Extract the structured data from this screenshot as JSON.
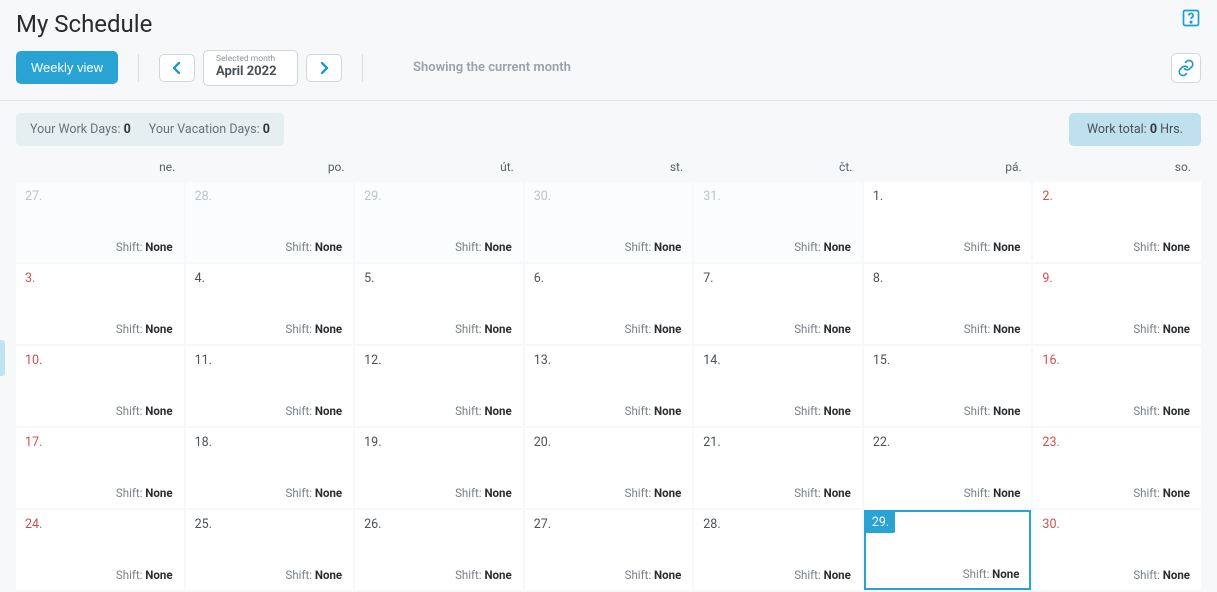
{
  "header": {
    "title": "My Schedule"
  },
  "toolbar": {
    "weekly_view_label": "Weekly view",
    "selected_month_label": "Selected month",
    "selected_month_value": "April 2022",
    "showing_text": "Showing the current month"
  },
  "summary": {
    "work_days_label": "Your Work Days:",
    "work_days_value": "0",
    "vacation_days_label": "Your Vacation Days:",
    "vacation_days_value": "0",
    "work_total_label": "Work total:",
    "work_total_value": "0",
    "work_total_unit": "Hrs."
  },
  "day_headers": [
    "ne.",
    "po.",
    "út.",
    "st.",
    "čt.",
    "pá.",
    "so."
  ],
  "shift_label": "Shift:",
  "shift_value": "None",
  "cells": [
    {
      "day": "27.",
      "faded": true,
      "weekend": false,
      "today": false
    },
    {
      "day": "28.",
      "faded": true,
      "weekend": false,
      "today": false
    },
    {
      "day": "29.",
      "faded": true,
      "weekend": false,
      "today": false
    },
    {
      "day": "30.",
      "faded": true,
      "weekend": false,
      "today": false
    },
    {
      "day": "31.",
      "faded": true,
      "weekend": false,
      "today": false
    },
    {
      "day": "1.",
      "faded": false,
      "weekend": false,
      "today": false
    },
    {
      "day": "2.",
      "faded": false,
      "weekend": true,
      "today": false
    },
    {
      "day": "3.",
      "faded": false,
      "weekend": true,
      "today": false
    },
    {
      "day": "4.",
      "faded": false,
      "weekend": false,
      "today": false
    },
    {
      "day": "5.",
      "faded": false,
      "weekend": false,
      "today": false
    },
    {
      "day": "6.",
      "faded": false,
      "weekend": false,
      "today": false
    },
    {
      "day": "7.",
      "faded": false,
      "weekend": false,
      "today": false
    },
    {
      "day": "8.",
      "faded": false,
      "weekend": false,
      "today": false
    },
    {
      "day": "9.",
      "faded": false,
      "weekend": true,
      "today": false
    },
    {
      "day": "10.",
      "faded": false,
      "weekend": true,
      "today": false
    },
    {
      "day": "11.",
      "faded": false,
      "weekend": false,
      "today": false
    },
    {
      "day": "12.",
      "faded": false,
      "weekend": false,
      "today": false
    },
    {
      "day": "13.",
      "faded": false,
      "weekend": false,
      "today": false
    },
    {
      "day": "14.",
      "faded": false,
      "weekend": false,
      "today": false
    },
    {
      "day": "15.",
      "faded": false,
      "weekend": false,
      "today": false
    },
    {
      "day": "16.",
      "faded": false,
      "weekend": true,
      "today": false
    },
    {
      "day": "17.",
      "faded": false,
      "weekend": true,
      "today": false
    },
    {
      "day": "18.",
      "faded": false,
      "weekend": false,
      "today": false
    },
    {
      "day": "19.",
      "faded": false,
      "weekend": false,
      "today": false
    },
    {
      "day": "20.",
      "faded": false,
      "weekend": false,
      "today": false
    },
    {
      "day": "21.",
      "faded": false,
      "weekend": false,
      "today": false
    },
    {
      "day": "22.",
      "faded": false,
      "weekend": false,
      "today": false
    },
    {
      "day": "23.",
      "faded": false,
      "weekend": true,
      "today": false
    },
    {
      "day": "24.",
      "faded": false,
      "weekend": true,
      "today": false
    },
    {
      "day": "25.",
      "faded": false,
      "weekend": false,
      "today": false
    },
    {
      "day": "26.",
      "faded": false,
      "weekend": false,
      "today": false
    },
    {
      "day": "27.",
      "faded": false,
      "weekend": false,
      "today": false
    },
    {
      "day": "28.",
      "faded": false,
      "weekend": false,
      "today": false
    },
    {
      "day": "29.",
      "faded": false,
      "weekend": false,
      "today": true
    },
    {
      "day": "30.",
      "faded": false,
      "weekend": true,
      "today": false
    }
  ]
}
